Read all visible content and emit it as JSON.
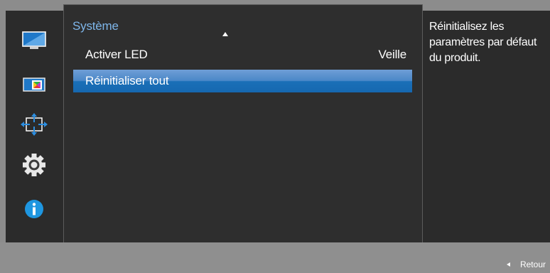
{
  "rail": {
    "icons": [
      {
        "name": "picture-icon"
      },
      {
        "name": "color-icon"
      },
      {
        "name": "size-position-icon"
      },
      {
        "name": "system-settings-icon"
      },
      {
        "name": "information-icon"
      }
    ]
  },
  "menu": {
    "title": "Système",
    "items": [
      {
        "label": "Activer LED",
        "value": "Veille",
        "selected": false
      },
      {
        "label": "Réinitialiser tout",
        "value": "",
        "selected": true
      }
    ]
  },
  "info": {
    "description": "Réinitialisez les paramètres par défaut du produit."
  },
  "footer": {
    "back_label": "Retour"
  },
  "colors": {
    "title_blue": "#7eb6ea",
    "selection_blue": "#1a6fb7",
    "info_icon_blue": "#1e96e0",
    "panel_dark": "#2e2e2e",
    "frame_gray": "#8c8c8c"
  }
}
